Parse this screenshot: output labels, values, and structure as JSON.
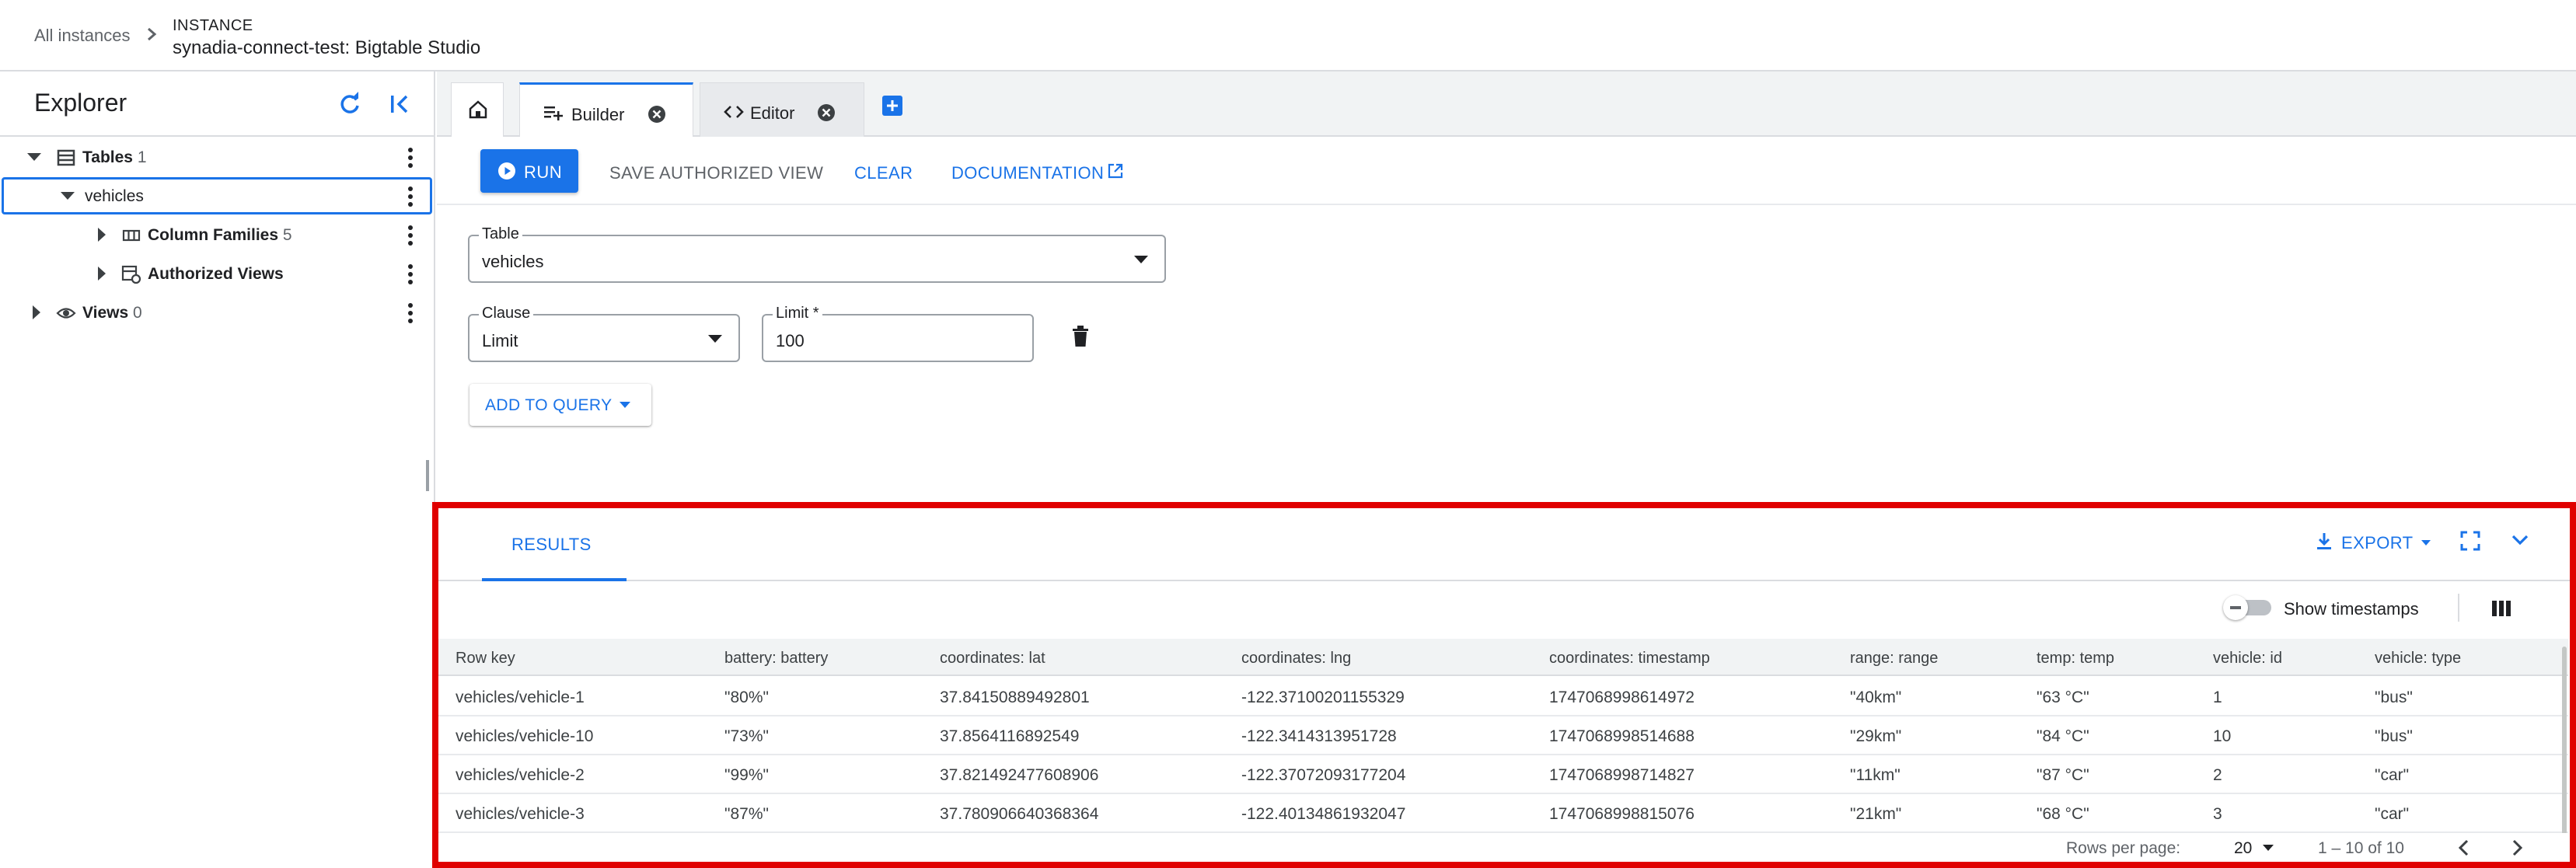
{
  "breadcrumb": {
    "all_instances": "All instances",
    "instance_label": "INSTANCE",
    "instance_name": "synadia-connect-test: Bigtable Studio"
  },
  "explorer": {
    "title": "Explorer",
    "refresh_icon": "refresh-icon",
    "collapse_icon": "collapse-left-icon",
    "tree": {
      "tables": {
        "label": "Tables",
        "count": "1",
        "icon": "table-icon"
      },
      "vehicles": {
        "label": "vehicles"
      },
      "column_families": {
        "label": "Column Families",
        "count": "5",
        "icon": "column-families-icon"
      },
      "authorized_views": {
        "label": "Authorized Views",
        "icon": "authorized-views-icon"
      },
      "views": {
        "label": "Views",
        "count": "0",
        "icon": "eye-icon"
      }
    }
  },
  "tabs": {
    "home_icon": "home-icon",
    "builder": {
      "label": "Builder",
      "icon": "playlist-add-icon"
    },
    "editor": {
      "label": "Editor",
      "icon": "code-icon"
    },
    "add_icon": "add-tab-icon"
  },
  "toolbar": {
    "run": "RUN",
    "save_authorized_view": "SAVE AUTHORIZED VIEW",
    "clear": "CLEAR",
    "documentation": "DOCUMENTATION"
  },
  "builder": {
    "table": {
      "label": "Table",
      "value": "vehicles"
    },
    "clause": {
      "label": "Clause",
      "value": "Limit"
    },
    "limit": {
      "label": "Limit *",
      "value": "100"
    },
    "add_to_query": "ADD TO QUERY"
  },
  "results": {
    "tab_label": "RESULTS",
    "export": "EXPORT",
    "show_timestamps": "Show timestamps",
    "show_timestamps_on": false,
    "columns": [
      "Row key",
      "battery: battery",
      "coordinates: lat",
      "coordinates: lng",
      "coordinates: timestamp",
      "range: range",
      "temp: temp",
      "vehicle: id",
      "vehicle: type"
    ],
    "rows": [
      [
        "vehicles/vehicle-1",
        "\"80%\"",
        "37.84150889492801",
        "-122.37100201155329",
        "1747068998614972",
        "\"40km\"",
        "\"63 °C\"",
        "1",
        "\"bus\""
      ],
      [
        "vehicles/vehicle-10",
        "\"73%\"",
        "37.8564116892549",
        "-122.3414313951728",
        "1747068998514688",
        "\"29km\"",
        "\"84 °C\"",
        "10",
        "\"bus\""
      ],
      [
        "vehicles/vehicle-2",
        "\"99%\"",
        "37.821492477608906",
        "-122.37072093177204",
        "1747068998714827",
        "\"11km\"",
        "\"87 °C\"",
        "2",
        "\"car\""
      ],
      [
        "vehicles/vehicle-3",
        "\"87%\"",
        "37.780906640368364",
        "-122.40134861932047",
        "1747068998815076",
        "\"21km\"",
        "\"68 °C\"",
        "3",
        "\"car\""
      ]
    ],
    "pagination": {
      "rows_per_page_label": "Rows per page:",
      "rows_per_page": "20",
      "range": "1 – 10 of 10"
    }
  },
  "colors": {
    "accent": "#1a73e8",
    "highlight_border": "#e00000",
    "text": "#202124",
    "muted": "#5f6368"
  }
}
